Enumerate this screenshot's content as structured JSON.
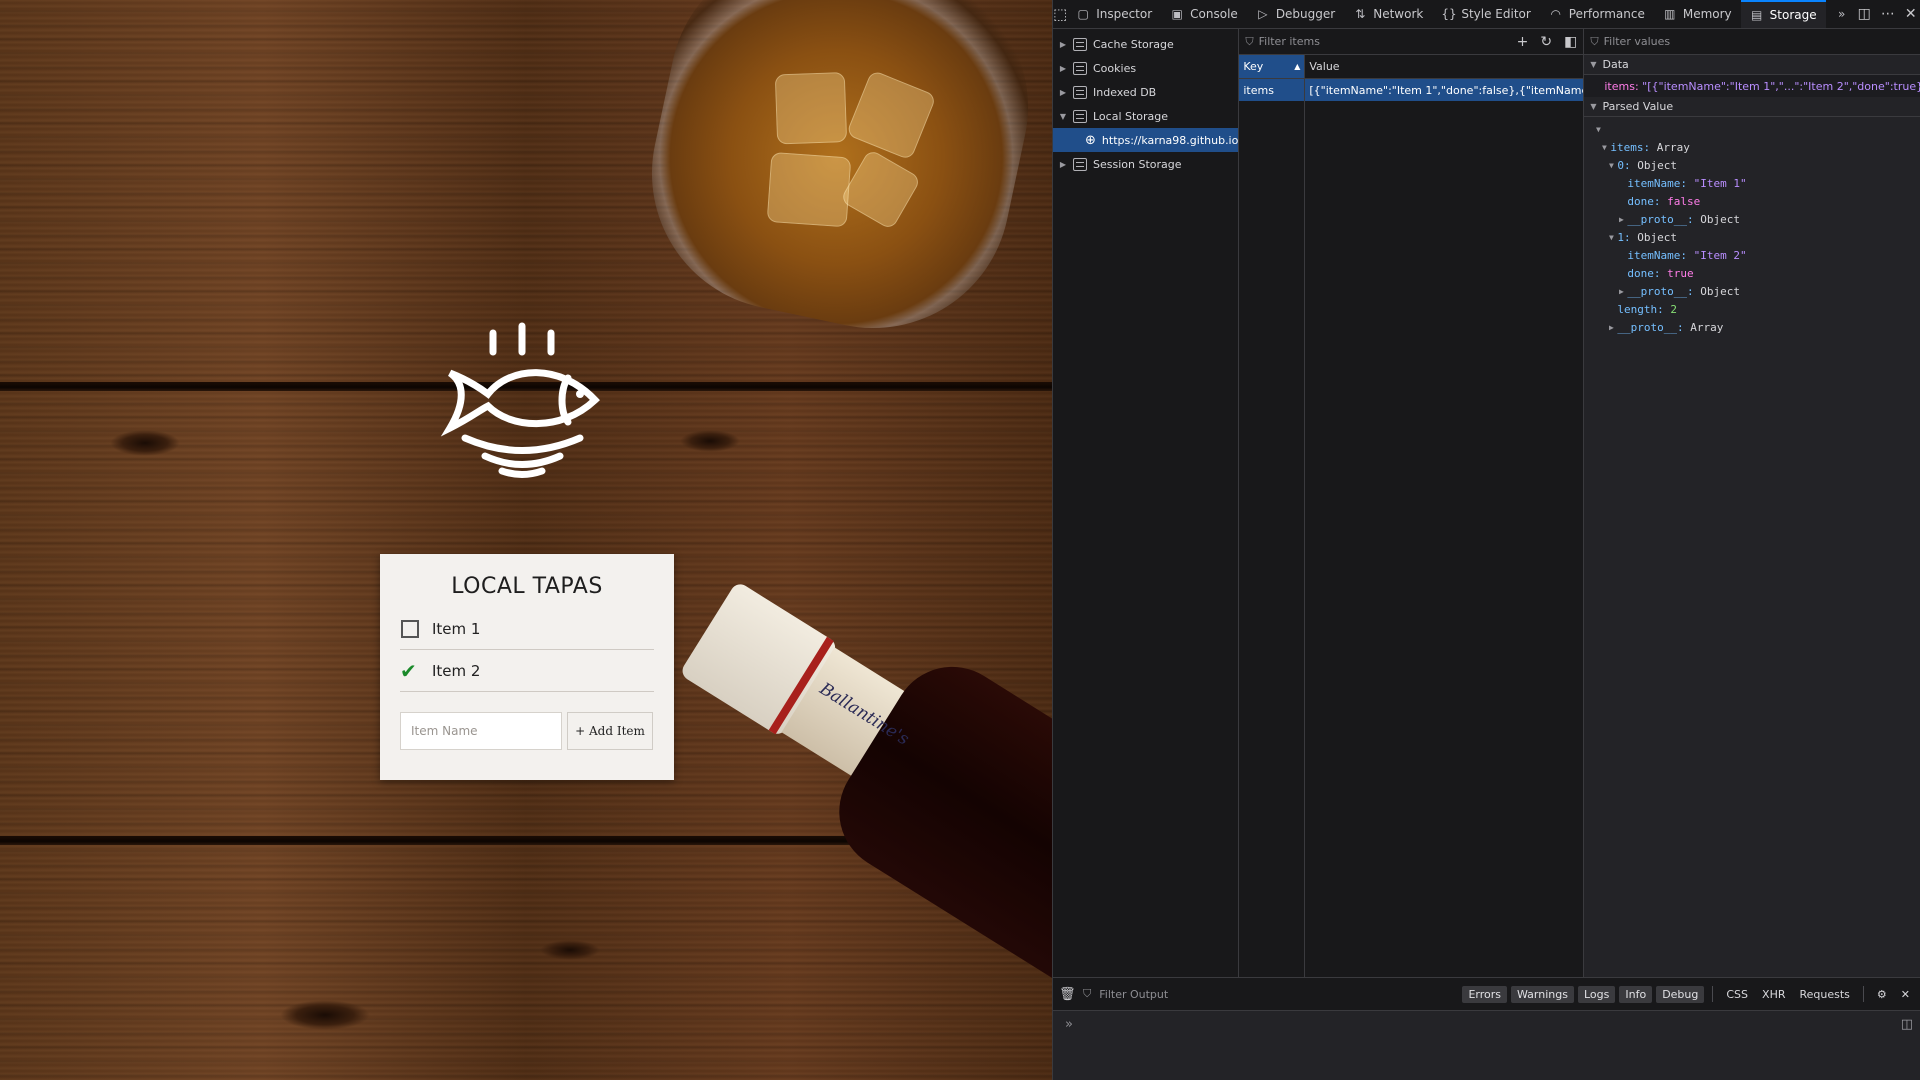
{
  "page": {
    "logo_name": "fish-plate-logo",
    "bottle_brand": "Ballantine's",
    "card": {
      "title": "LOCAL TAPAS",
      "items": [
        {
          "label": "Item 1",
          "done": false
        },
        {
          "label": "Item 2",
          "done": true
        }
      ],
      "input_placeholder": "Item Name",
      "add_button": "+ Add Item"
    }
  },
  "devtools": {
    "tabs": [
      {
        "label": "Inspector",
        "icon": "inspector-icon"
      },
      {
        "label": "Console",
        "icon": "console-icon"
      },
      {
        "label": "Debugger",
        "icon": "debugger-icon"
      },
      {
        "label": "Network",
        "icon": "network-icon"
      },
      {
        "label": "Style Editor",
        "icon": "style-editor-icon"
      },
      {
        "label": "Performance",
        "icon": "performance-icon"
      },
      {
        "label": "Memory",
        "icon": "memory-icon"
      },
      {
        "label": "Storage",
        "icon": "storage-icon",
        "active": true
      }
    ],
    "tree": {
      "cache_storage": "Cache Storage",
      "cookies": "Cookies",
      "indexed_db": "Indexed DB",
      "local_storage": "Local Storage",
      "local_storage_origin": "https://karna98.github.io",
      "session_storage": "Session Storage"
    },
    "table": {
      "filter_placeholder": "Filter items",
      "key_header": "Key",
      "value_header": "Value",
      "row_key": "items",
      "row_value": "[{\"itemName\":\"Item 1\",\"done\":false},{\"itemName\":\"Ite..."
    },
    "sidebar": {
      "filter_placeholder": "Filter values",
      "data_header": "Data",
      "data_key": "items:",
      "data_value": "\"[{\"itemName\":\"Item 1\",\"...\":\"Item 2\",\"done\":true}]\"",
      "parsed_header": "Parsed Value",
      "parsed": {
        "items_label": "items:",
        "items_type": "Array",
        "obj0_label": "0:",
        "obj0_type": "Object",
        "obj0_itemName_key": "itemName:",
        "obj0_itemName_val": "\"Item 1\"",
        "obj0_done_key": "done:",
        "obj0_done_val": "false",
        "obj0_proto_key": "__proto__:",
        "obj0_proto_val": "Object",
        "obj1_label": "1:",
        "obj1_type": "Object",
        "obj1_itemName_key": "itemName:",
        "obj1_itemName_val": "\"Item 2\"",
        "obj1_done_key": "done:",
        "obj1_done_val": "true",
        "obj1_proto_key": "__proto__:",
        "obj1_proto_val": "Object",
        "length_key": "length:",
        "length_val": "2",
        "arr_proto_key": "__proto__:",
        "arr_proto_val": "Array"
      }
    },
    "console": {
      "filter_placeholder": "Filter Output",
      "level_buttons": [
        "Errors",
        "Warnings",
        "Logs",
        "Info",
        "Debug"
      ],
      "type_buttons": [
        "CSS",
        "XHR",
        "Requests"
      ]
    }
  }
}
